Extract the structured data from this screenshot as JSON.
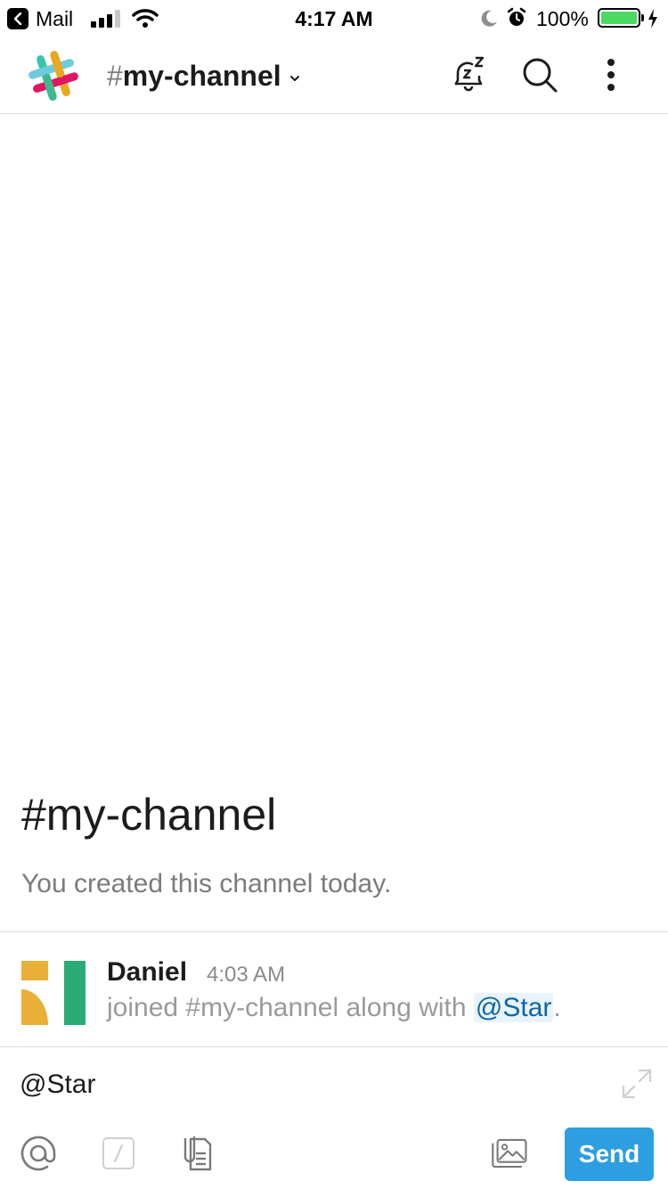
{
  "status_bar": {
    "back_app": "Mail",
    "time": "4:17 AM",
    "battery": "100%",
    "battery_level": 1.0,
    "signal_bars": 3,
    "icons": [
      "back-icon",
      "signal-icon",
      "wifi-icon",
      "moon-icon",
      "alarm-icon",
      "battery-icon",
      "charging-icon"
    ]
  },
  "header": {
    "hash": "#",
    "channel_name": "my-channel",
    "icons": [
      "slack-logo",
      "chevron-down-icon",
      "snooze-bell-icon",
      "search-icon",
      "more-vertical-icon"
    ]
  },
  "intro": {
    "title": "#my-channel",
    "subtitle": "You created this channel today."
  },
  "message": {
    "author": "Daniel",
    "time": "4:03 AM",
    "text_before": "joined #my-channel along with ",
    "mention": "@Star",
    "text_after": "."
  },
  "composer": {
    "input_value": "@Star",
    "send_label": "Send",
    "icons": [
      "expand-icon",
      "at-mention-icon",
      "slash-command-icon",
      "file-icon",
      "image-icon"
    ]
  },
  "colors": {
    "send_button": "#2d9ee0",
    "mention_text": "#1264a3",
    "mention_bg": "#e8f4fb",
    "battery_fill": "#4cd964",
    "avatar_yellow": "#e8b037",
    "avatar_green": "#2bac76"
  }
}
